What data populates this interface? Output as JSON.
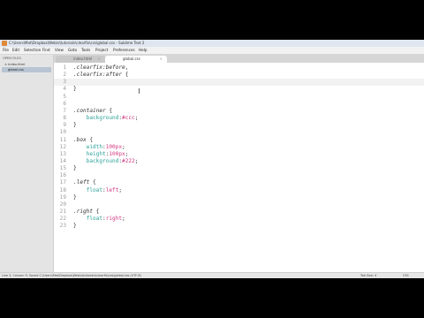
{
  "window": {
    "title": "C:\\Users\\Mat\\Dropbox\\Web\\s\\tutorials\\clearfix\\css\\global.css - Sublime Text 2"
  },
  "menu": [
    "File",
    "Edit",
    "Selection",
    "Find",
    "View",
    "Goto",
    "Tools",
    "Project",
    "Preferences",
    "Help"
  ],
  "sidebar": {
    "header": "OPEN FILES",
    "items": [
      {
        "label": "index.html",
        "prefix": "×"
      },
      {
        "label": "global.css",
        "prefix": ""
      }
    ]
  },
  "tabs": [
    {
      "label": "index.html",
      "close": "×",
      "active": false
    },
    {
      "label": "global.css",
      "close": "×",
      "active": true
    }
  ],
  "editor": {
    "current_line": 3,
    "lines": [
      {
        "n": "1",
        "tokens": [
          {
            "t": ".clearfix",
            "c": "sel"
          },
          {
            "t": ":before",
            "c": "pseudo"
          },
          {
            "t": ",",
            "c": "punc"
          }
        ]
      },
      {
        "n": "2",
        "tokens": [
          {
            "t": ".clearfix",
            "c": "sel"
          },
          {
            "t": ":after",
            "c": "pseudo"
          },
          {
            "t": " {",
            "c": "punc"
          }
        ]
      },
      {
        "n": "3",
        "tokens": []
      },
      {
        "n": "4",
        "tokens": [
          {
            "t": "}",
            "c": "punc"
          }
        ]
      },
      {
        "n": "5",
        "tokens": []
      },
      {
        "n": "6",
        "tokens": []
      },
      {
        "n": "7",
        "tokens": [
          {
            "t": ".container",
            "c": "sel"
          },
          {
            "t": " {",
            "c": "punc"
          }
        ]
      },
      {
        "n": "8",
        "tokens": [
          {
            "t": "    background",
            "c": "prop"
          },
          {
            "t": ":",
            "c": "punc"
          },
          {
            "t": "#ccc",
            "c": "val"
          },
          {
            "t": ";",
            "c": "punc"
          }
        ]
      },
      {
        "n": "9",
        "tokens": [
          {
            "t": "}",
            "c": "punc"
          }
        ]
      },
      {
        "n": "10",
        "tokens": []
      },
      {
        "n": "11",
        "tokens": [
          {
            "t": ".box",
            "c": "sel"
          },
          {
            "t": " {",
            "c": "punc"
          }
        ]
      },
      {
        "n": "12",
        "tokens": [
          {
            "t": "    width",
            "c": "prop"
          },
          {
            "t": ":",
            "c": "punc"
          },
          {
            "t": "100px",
            "c": "val"
          },
          {
            "t": ";",
            "c": "punc"
          }
        ]
      },
      {
        "n": "13",
        "tokens": [
          {
            "t": "    height",
            "c": "prop"
          },
          {
            "t": ":",
            "c": "punc"
          },
          {
            "t": "100px",
            "c": "val"
          },
          {
            "t": ";",
            "c": "punc"
          }
        ]
      },
      {
        "n": "14",
        "tokens": [
          {
            "t": "    background",
            "c": "prop"
          },
          {
            "t": ":",
            "c": "punc"
          },
          {
            "t": "#222",
            "c": "val"
          },
          {
            "t": ";",
            "c": "punc"
          }
        ]
      },
      {
        "n": "15",
        "tokens": [
          {
            "t": "}",
            "c": "punc"
          }
        ]
      },
      {
        "n": "16",
        "tokens": []
      },
      {
        "n": "17",
        "tokens": [
          {
            "t": ".left",
            "c": "sel"
          },
          {
            "t": " {",
            "c": "punc"
          }
        ]
      },
      {
        "n": "18",
        "tokens": [
          {
            "t": "    float",
            "c": "prop"
          },
          {
            "t": ":",
            "c": "punc"
          },
          {
            "t": "left",
            "c": "val"
          },
          {
            "t": ";",
            "c": "punc"
          }
        ]
      },
      {
        "n": "19",
        "tokens": [
          {
            "t": "}",
            "c": "punc"
          }
        ]
      },
      {
        "n": "20",
        "tokens": []
      },
      {
        "n": "21",
        "tokens": [
          {
            "t": ".right",
            "c": "sel"
          },
          {
            "t": " {",
            "c": "punc"
          }
        ]
      },
      {
        "n": "22",
        "tokens": [
          {
            "t": "    float",
            "c": "prop"
          },
          {
            "t": ":",
            "c": "punc"
          },
          {
            "t": "right",
            "c": "val"
          },
          {
            "t": ";",
            "c": "punc"
          }
        ]
      },
      {
        "n": "23",
        "tokens": [
          {
            "t": "}",
            "c": "punc"
          }
        ]
      }
    ]
  },
  "status": {
    "left": "Line 3, Column 9; Saved C:\\Users\\Mat\\Dropbox\\Web\\s\\tutorials\\clearfix\\css\\global.css (UTF-8)",
    "tab_size": "Tab Size: 4",
    "syntax": "CSS"
  },
  "colors": {
    "selector": "#333333",
    "property": "#2aa198",
    "value": "#d33682",
    "accent": "#e0883a"
  }
}
